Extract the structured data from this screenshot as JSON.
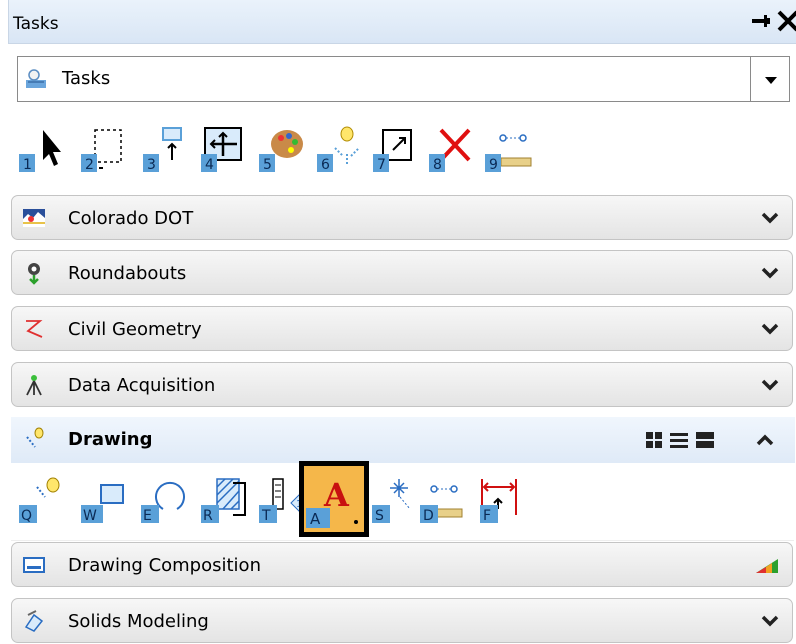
{
  "window": {
    "title": "Tasks",
    "pin_icon": "pin-icon",
    "close_icon": "close-icon"
  },
  "task_selector": {
    "selected": "Tasks",
    "icon": "tasks-icon",
    "dropdown_icon": "dropdown-arrow-icon"
  },
  "main_tools": {
    "keys": [
      "1",
      "2",
      "3",
      "4",
      "5",
      "6",
      "7",
      "8",
      "9"
    ],
    "icons": [
      "arrow-select-icon",
      "fence-icon",
      "move-icon",
      "manipulate-icon",
      "palette-icon",
      "place-light-icon",
      "window-icon",
      "delete-icon",
      "measure-icon"
    ]
  },
  "sections": [
    {
      "label": "Colorado DOT",
      "icon": "colorado-dot-icon",
      "state": "collapsed"
    },
    {
      "label": "Roundabouts",
      "icon": "roundabouts-icon",
      "state": "collapsed"
    },
    {
      "label": "Civil Geometry",
      "icon": "civil-geometry-icon",
      "state": "collapsed"
    },
    {
      "label": "Data Acquisition",
      "icon": "data-acquisition-icon",
      "state": "collapsed"
    }
  ],
  "drawing": {
    "label": "Drawing",
    "icon": "drawing-icon",
    "view_icons": [
      "grid-view-icon",
      "list-view-icon",
      "wide-view-icon",
      "collapse-icon"
    ],
    "tools": {
      "keys": [
        "Q",
        "W",
        "E",
        "R",
        "T",
        "A",
        "S",
        "D",
        "F"
      ],
      "icons": [
        "element-selection-icon",
        "place-shape-icon",
        "place-arc-icon",
        "hatch-icon",
        "text-tools-icon",
        "place-text-icon",
        "place-cell-icon",
        "measure-icon",
        "dimension-icon"
      ],
      "selected_index": 5
    }
  },
  "bottom_sections": [
    {
      "label": "Drawing Composition",
      "icon": "drawing-composition-icon",
      "trailing_icon": "status-bars-icon"
    },
    {
      "label": "Solids Modeling",
      "icon": "solids-modeling-icon",
      "trailing_icon": "chevron-down-icon"
    }
  ],
  "colors": {
    "title_bg": "#d9e6f5",
    "section_bg": "#e8e8e8",
    "selected_tool_bg": "#f5b74a",
    "key_box": "#5aa0d8",
    "delete_red": "#e01010"
  }
}
